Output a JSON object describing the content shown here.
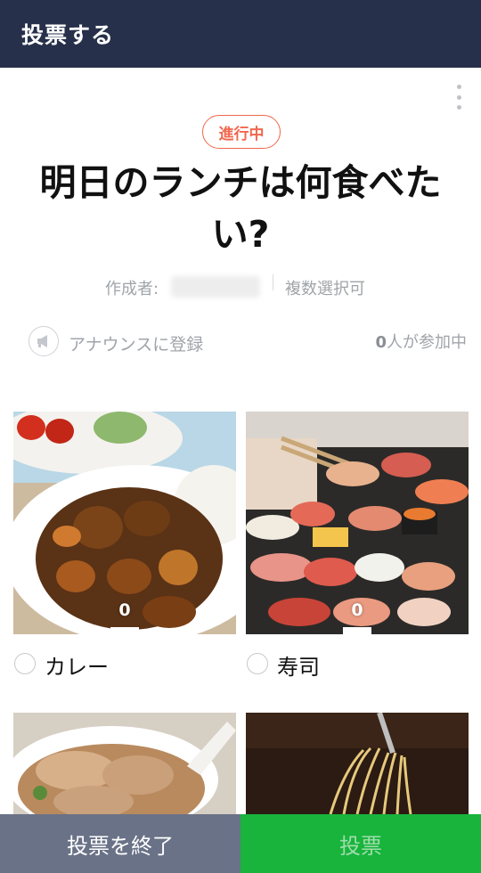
{
  "header": {
    "title": "投票する"
  },
  "poll": {
    "status": "進行中",
    "title": "明日のランチは何食べたい?",
    "author_label": "作成者:",
    "multi_select": "複数選択可",
    "announce_label": "アナウンスに登録",
    "participants_count": "0",
    "participants_suffix": "人が参加中"
  },
  "options": [
    {
      "label": "カレー",
      "count": "0"
    },
    {
      "label": "寿司",
      "count": "0"
    },
    {
      "label": "",
      "count": ""
    },
    {
      "label": "",
      "count": ""
    }
  ],
  "footer": {
    "end_label": "投票を終了",
    "vote_label": "投票"
  },
  "colors": {
    "header": "#27304a",
    "badge": "#f0674e",
    "end_button": "#6a7287",
    "vote_button": "#18b43c"
  }
}
